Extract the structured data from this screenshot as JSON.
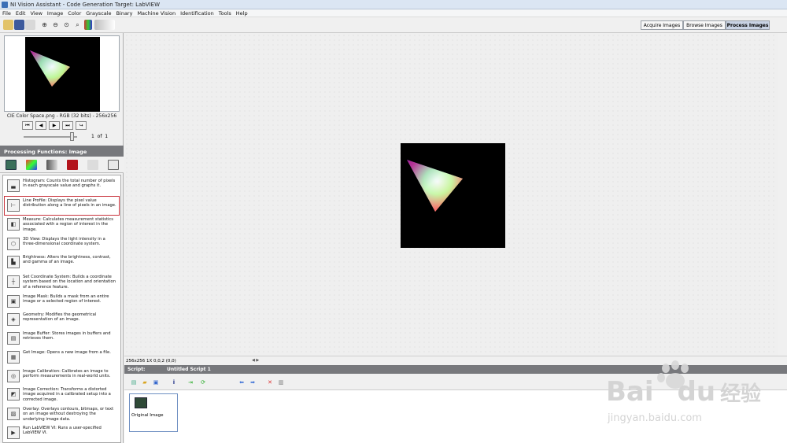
{
  "window": {
    "title": "NI Vision Assistant - Code Generation Target: LabVIEW"
  },
  "menu": [
    "File",
    "Edit",
    "View",
    "Image",
    "Color",
    "Grayscale",
    "Binary",
    "Machine Vision",
    "Identification",
    "Tools",
    "Help"
  ],
  "mode_buttons": {
    "acquire": "Acquire Images",
    "browse": "Browse Images",
    "process": "Process Images"
  },
  "browser": {
    "caption": "CIE Color Space.png - RGB (32 bits) - 256x256",
    "page": "1",
    "of": "of",
    "total": "1"
  },
  "processing": {
    "header": "Processing Functions: Image"
  },
  "functions": [
    {
      "name": "Histogram",
      "desc": "Histogram:  Counts the total number of pixels in each grayscale value and graphs it.",
      "icon": "histogram-icon",
      "glyph": "▃"
    },
    {
      "name": "Line Profile",
      "desc": "Line Profile:  Displays the pixel value distribution along a line of pixels in an image.",
      "icon": "line-profile-icon",
      "glyph": "⊢",
      "selected": true
    },
    {
      "name": "Measure",
      "desc": "Measure:  Calculates measurement statistics associated with a region of interest in the image.",
      "icon": "measure-icon",
      "glyph": "◧"
    },
    {
      "name": "3D View",
      "desc": "3D View:  Displays the light intensity in a three-dimensional coordinate system.",
      "icon": "3d-view-icon",
      "glyph": "⬡"
    },
    {
      "name": "Brightness",
      "desc": "Brightness:  Alters the brightness, contrast, and gamma of an image.",
      "icon": "brightness-icon",
      "glyph": "▙"
    },
    {
      "name": "Set Coordinate System",
      "desc": "Set Coordinate System:  Builds a coordinate system based on the location and orientation of a reference feature.",
      "icon": "coordinate-system-icon",
      "glyph": "┼"
    },
    {
      "name": "Image Mask",
      "desc": "Image Mask:  Builds a mask from an entire image or a selected region of interest.",
      "icon": "image-mask-icon",
      "glyph": "▣"
    },
    {
      "name": "Geometry",
      "desc": "Geometry:  Modifies the geometrical representation of an image.",
      "icon": "geometry-icon",
      "glyph": "◈"
    },
    {
      "name": "Image Buffer",
      "desc": "Image Buffer:  Stores images in buffers and retrieves them.",
      "icon": "image-buffer-icon",
      "glyph": "▤"
    },
    {
      "name": "Get Image",
      "desc": "Get Image:  Opens a new image from a file.",
      "icon": "get-image-icon",
      "glyph": "▦"
    },
    {
      "name": "Image Calibration",
      "desc": "Image Calibration:  Calibrates an image to perform measurements in real-world units.",
      "icon": "image-calibration-icon",
      "glyph": "◎"
    },
    {
      "name": "Image Correction",
      "desc": "Image Correction:  Transforms a distorted image acquired in a calibrated setup into a corrected image.",
      "icon": "image-correction-icon",
      "glyph": "◩"
    },
    {
      "name": "Overlay",
      "desc": "Overlay:  Overlays contours, bitmaps, or text on an image without destroying the underlying image data.",
      "icon": "overlay-icon",
      "glyph": "▨"
    },
    {
      "name": "Run LabVIEW VI",
      "desc": "Run LabVIEW VI:  Runs a user-specified LabVIEW VI.",
      "icon": "run-vi-icon",
      "glyph": "▶"
    }
  ],
  "status": {
    "text": "256x256 1X 0,0,2     (0,0)"
  },
  "script": {
    "label": "Script:",
    "name": "Untitled Script 1",
    "step_label": "Original Image"
  },
  "watermark": {
    "brand": "Bai",
    "brand2": "du",
    "cn": "经验",
    "url": "jingyan.baidu.com"
  },
  "colors": {
    "panel_header": "#77787c",
    "selection": "#c8323c",
    "active_mode": "#c9d3e4"
  }
}
